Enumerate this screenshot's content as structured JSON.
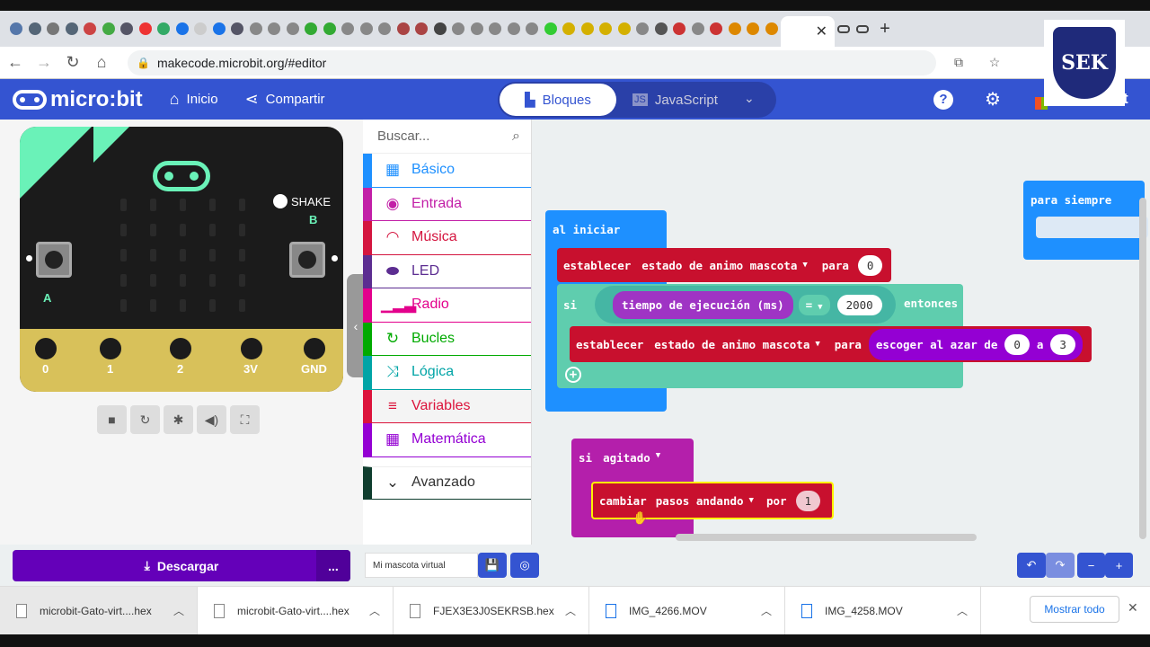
{
  "browser": {
    "url": "makecode.microbit.org/#editor",
    "new_tab": "+",
    "tab_close": "✕"
  },
  "header": {
    "brand": "micro:bit",
    "home": "Inicio",
    "share": "Compartir",
    "mode_blocks": "Bloques",
    "mode_js": "JavaScript",
    "ms_text": "oft"
  },
  "logo_text": "SEK",
  "simulator": {
    "shake": "SHAKE",
    "button_a": "A",
    "button_b": "B",
    "pins": [
      "0",
      "1",
      "2",
      "3V",
      "GND"
    ]
  },
  "toolbox": {
    "search_placeholder": "Buscar...",
    "categories": [
      {
        "label": "Básico",
        "color": "#1e90ff"
      },
      {
        "label": "Entrada",
        "color": "#c21fa7"
      },
      {
        "label": "Música",
        "color": "#d4153f"
      },
      {
        "label": "LED",
        "color": "#5c2d91"
      },
      {
        "label": "Radio",
        "color": "#e3008c"
      },
      {
        "label": "Bucles",
        "color": "#00aa00"
      },
      {
        "label": "Lógica",
        "color": "#00a4a6"
      },
      {
        "label": "Variables",
        "color": "#dc143c"
      },
      {
        "label": "Matemática",
        "color": "#9400d3"
      }
    ],
    "advanced": "Avanzado"
  },
  "blocks": {
    "on_start": "al iniciar",
    "set1": {
      "kw": "establecer",
      "var": "estado de animo mascota",
      "to": "para",
      "val": "0"
    },
    "if": {
      "kw": "si",
      "cond": "tiempo de ejecución (ms)",
      "op": "=",
      "val": "2000",
      "then": "entonces"
    },
    "set2": {
      "kw": "establecer",
      "var": "estado de animo mascota",
      "to": "para",
      "random": "escoger al azar de",
      "from": "0",
      "a": "a",
      "to_val": "3"
    },
    "forever": "para siempre",
    "on_gesture": {
      "kw": "si",
      "gesture": "agitado"
    },
    "change": {
      "kw": "cambiar",
      "var": "pasos andando",
      "by": "por",
      "val": "1"
    }
  },
  "bottom": {
    "download": "Descargar",
    "more": "...",
    "project_name": "Mi mascota virtual"
  },
  "downloads": {
    "items": [
      "microbit-Gato-virt....hex",
      "microbit-Gato-virt....hex",
      "FJEX3E3J0SEKRSB.hex",
      "IMG_4266.MOV",
      "IMG_4258.MOV"
    ],
    "show_all": "Mostrar todo"
  }
}
